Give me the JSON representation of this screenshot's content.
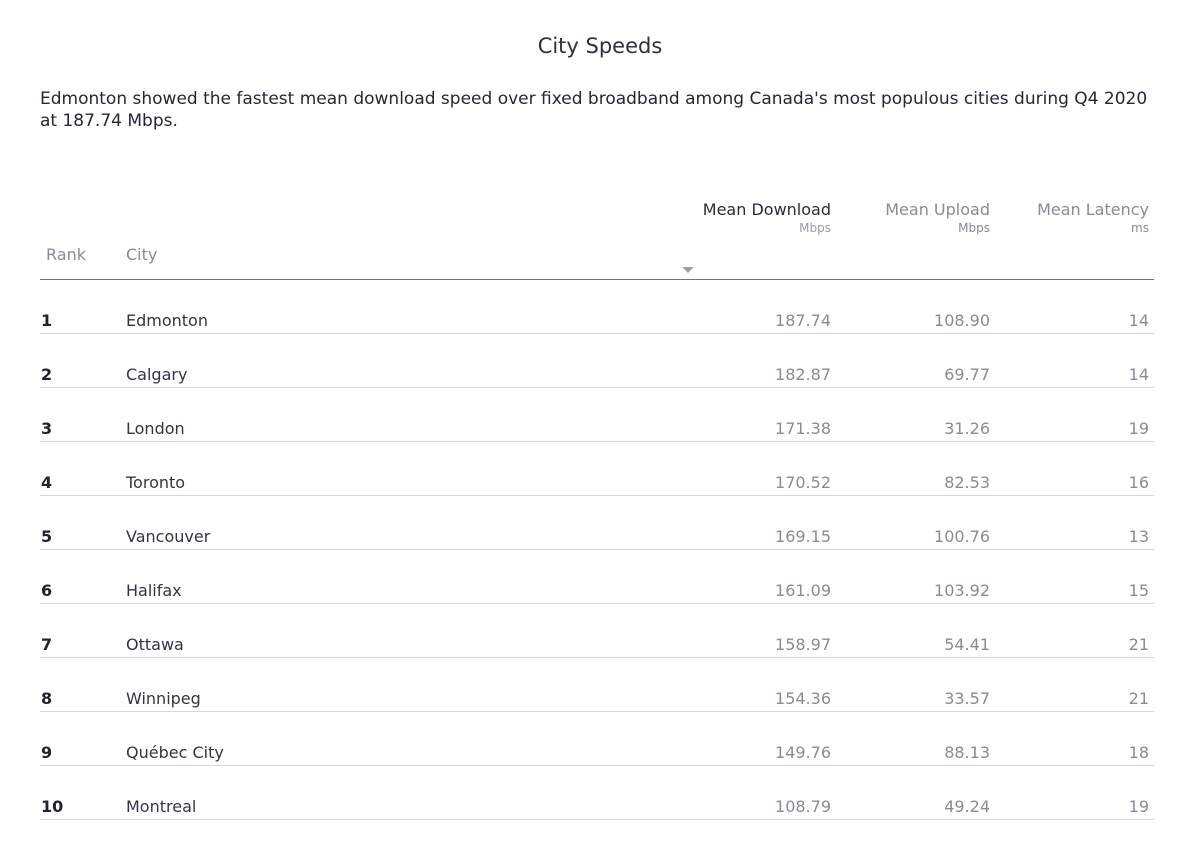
{
  "title": "City Speeds",
  "subtitle": "Edmonton showed the fastest mean download speed over fixed broadband among Canada's most populous cities during Q4 2020 at 187.74 Mbps.",
  "sort_icon": "caret-down-icon",
  "colors": {
    "text": "#2b2b3b",
    "muted": "#8a8a98",
    "rule": "#d6d6dc",
    "header_rule": "#707080"
  },
  "columns": {
    "rank": "Rank",
    "city": "City",
    "download": {
      "label": "Mean Download",
      "unit": "Mbps"
    },
    "upload": {
      "label": "Mean Upload",
      "unit": "Mbps"
    },
    "latency": {
      "label": "Mean Latency",
      "unit": "ms"
    }
  },
  "chart_data": {
    "type": "table",
    "title": "City Speeds",
    "columns": [
      "Rank",
      "City",
      "Mean Download (Mbps)",
      "Mean Upload (Mbps)",
      "Mean Latency (ms)"
    ],
    "sorted_by": "Mean Download",
    "rows": [
      {
        "rank": "1",
        "city": "Edmonton",
        "download": "187.74",
        "upload": "108.90",
        "latency": "14"
      },
      {
        "rank": "2",
        "city": "Calgary",
        "download": "182.87",
        "upload": "69.77",
        "latency": "14"
      },
      {
        "rank": "3",
        "city": "London",
        "download": "171.38",
        "upload": "31.26",
        "latency": "19"
      },
      {
        "rank": "4",
        "city": "Toronto",
        "download": "170.52",
        "upload": "82.53",
        "latency": "16"
      },
      {
        "rank": "5",
        "city": "Vancouver",
        "download": "169.15",
        "upload": "100.76",
        "latency": "13"
      },
      {
        "rank": "6",
        "city": "Halifax",
        "download": "161.09",
        "upload": "103.92",
        "latency": "15"
      },
      {
        "rank": "7",
        "city": "Ottawa",
        "download": "158.97",
        "upload": "54.41",
        "latency": "21"
      },
      {
        "rank": "8",
        "city": "Winnipeg",
        "download": "154.36",
        "upload": "33.57",
        "latency": "21"
      },
      {
        "rank": "9",
        "city": "Québec City",
        "download": "149.76",
        "upload": "88.13",
        "latency": "18"
      },
      {
        "rank": "10",
        "city": "Montreal",
        "download": "108.79",
        "upload": "49.24",
        "latency": "19"
      }
    ]
  }
}
